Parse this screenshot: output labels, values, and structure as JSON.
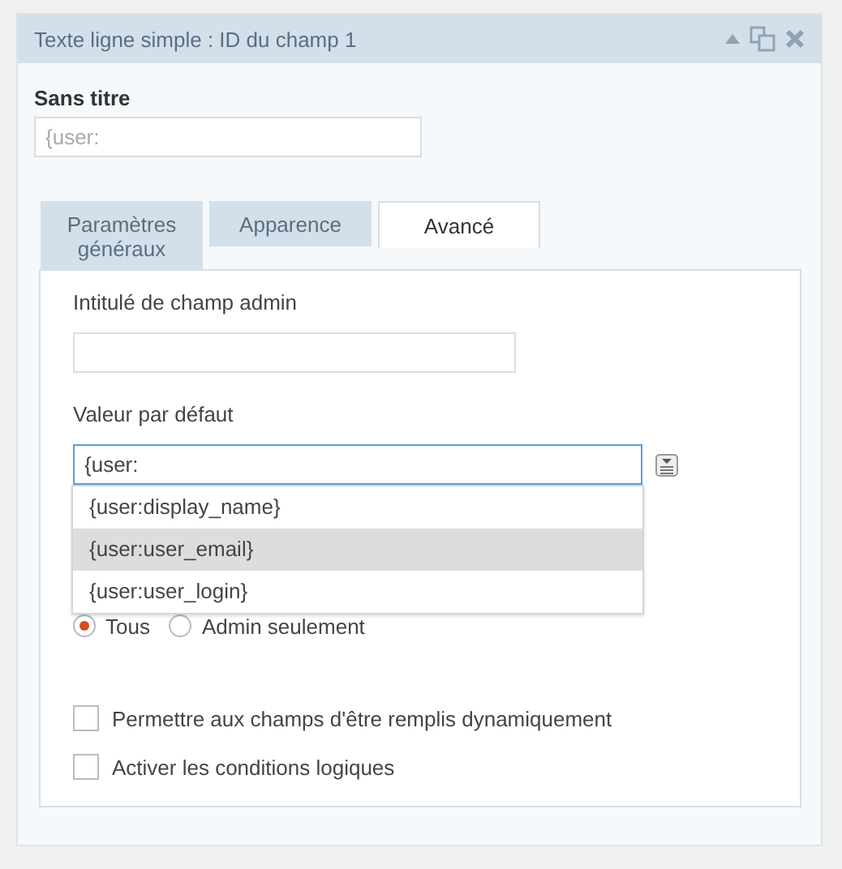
{
  "header": {
    "title": "Texte ligne simple : ID du champ 1"
  },
  "field_label": {
    "label": "Sans titre",
    "placeholder": "{user:"
  },
  "tabs": [
    {
      "label": "Paramètres généraux",
      "selected": false
    },
    {
      "label": "Apparence",
      "selected": false
    },
    {
      "label": "Avancé",
      "selected": true
    }
  ],
  "admin_label": {
    "label": "Intitulé de champ admin"
  },
  "default_value": {
    "label": "Valeur par défaut",
    "value": "{user:",
    "suggestions": [
      {
        "label": "{user:display_name}",
        "selected": false
      },
      {
        "label": "{user:user_email}",
        "selected": true
      },
      {
        "label": "{user:user_login}",
        "selected": false
      }
    ]
  },
  "visibility": [
    {
      "label": "Tous",
      "selected": true
    },
    {
      "label": "Admin seulement",
      "selected": false
    }
  ],
  "options": [
    {
      "label": "Permettre aux champs d'être remplis dynamiquement",
      "checked": false
    },
    {
      "label": "Activer les conditions logiques",
      "checked": false
    }
  ]
}
